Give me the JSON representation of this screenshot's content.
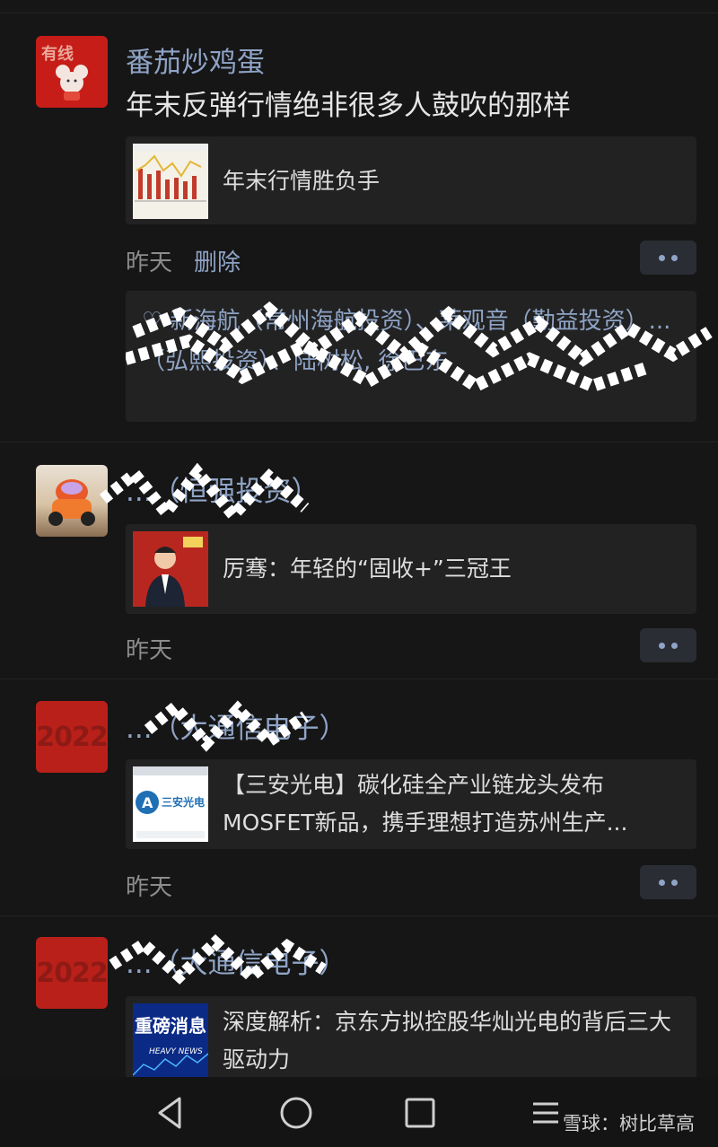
{
  "posts": [
    {
      "author": "番茄炒鸡蛋",
      "text": "年末反弹行情绝非很多人鼓吹的那样",
      "card_title": "年末行情胜负手",
      "time": "昨天",
      "delete_label": "删除",
      "likes_text": "♡ 新海航（常州海航投资）、莱观音（勤益投资）...（弘熙投资）、陆树松, 徐巴东"
    },
    {
      "author": "...（恒强投资）",
      "card_title": "厉骞：年轻的“固收+”三冠王",
      "time": "昨天"
    },
    {
      "author": "...（大通信电子）",
      "card_title": "【三安光电】碳化硅全产业链龙头发布MOSFET新品，携手理想打造苏州生产...",
      "time": "昨天",
      "avatar_text": "2022",
      "thumb_label": "三安光电"
    },
    {
      "author": "...（大通信电子）",
      "card_title": "深度解析：京东方拟控股华灿光电的背后三大驱动力",
      "avatar_text": "2022",
      "thumb_label": "重磅消息",
      "thumb_sublabel": "HEAVY NEWS"
    }
  ],
  "avatar1_label": "有线",
  "watermark": "雪球：树比草高",
  "nav": [
    "back-icon",
    "home-icon",
    "recents-icon",
    "menu-icon"
  ],
  "colors": {
    "background": "#161616",
    "card": "#222222",
    "link": "#8fa4c6",
    "text": "#e6e6e6",
    "muted": "#8c8c8c"
  }
}
